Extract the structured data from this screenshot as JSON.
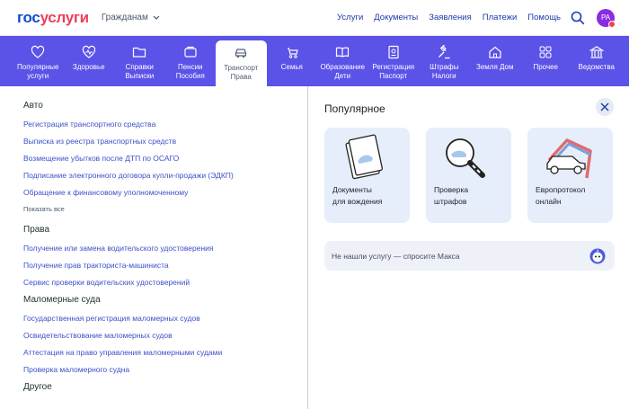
{
  "header": {
    "logo_left": "гос",
    "logo_right": "услуги",
    "audience": "Гражданам",
    "nav": [
      "Услуги",
      "Документы",
      "Заявления",
      "Платежи",
      "Помощь"
    ],
    "avatar": "PA"
  },
  "categories": [
    {
      "label": "Популярные\nуслуги",
      "icon": "heart-icon"
    },
    {
      "label": "Здоровье",
      "icon": "health-icon"
    },
    {
      "label": "Справки\nВыписки",
      "icon": "folder-icon"
    },
    {
      "label": "Пенсии\nПособия",
      "icon": "wallet-icon"
    },
    {
      "label": "Транспорт\nПрава",
      "icon": "car-icon",
      "active": true
    },
    {
      "label": "Семья",
      "icon": "stroller-icon"
    },
    {
      "label": "Образование\nДети",
      "icon": "book-icon"
    },
    {
      "label": "Регистрация\nПаспорт",
      "icon": "passport-icon"
    },
    {
      "label": "Штрафы\nНалоги",
      "icon": "gavel-icon"
    },
    {
      "label": "Земля Дом",
      "icon": "house-icon"
    },
    {
      "label": "Прочее",
      "icon": "grid-icon"
    },
    {
      "label": "Ведомства",
      "icon": "building-icon"
    }
  ],
  "sections": {
    "auto": {
      "title": "Авто",
      "links": [
        "Регистрация транспортного средства",
        "Выписка из реестра транспортных средств",
        "Возмещение убытков после ДТП по ОСАГО",
        "Подписание электронного договора купли-продажи (ЭДКП)",
        "Обращение к финансовому уполномоченному"
      ],
      "show_all": "Показать все"
    },
    "rights": {
      "title": "Права",
      "links": [
        "Получение или замена водительского удостоверения",
        "Получение прав тракториста-машиниста",
        "Сервис проверки водительских удостоверений"
      ]
    },
    "boats": {
      "title": "Маломерные суда",
      "links": [
        "Государственная регистрация маломерных судов",
        "Освидетельствование маломерных судов",
        "Аттестация на право управления маломерными судами",
        "Проверка маломерного судна"
      ]
    },
    "other": {
      "title": "Другое"
    }
  },
  "popular": {
    "title": "Популярное",
    "cards": [
      {
        "label": "Документы\nдля вождения",
        "icon": "documents-icon"
      },
      {
        "label": "Проверка\nштрафов",
        "icon": "magnifier-icon"
      },
      {
        "label": "Европротокол\nонлайн",
        "icon": "car-outline-icon"
      }
    ],
    "ask": "Не нашли услугу — спросите Макса"
  },
  "colors": {
    "accent": "#5b52e8",
    "link": "#3c50c8",
    "card": "#e6eefb",
    "logo_blue": "#0d4cd3",
    "logo_red": "#ee3f58"
  }
}
